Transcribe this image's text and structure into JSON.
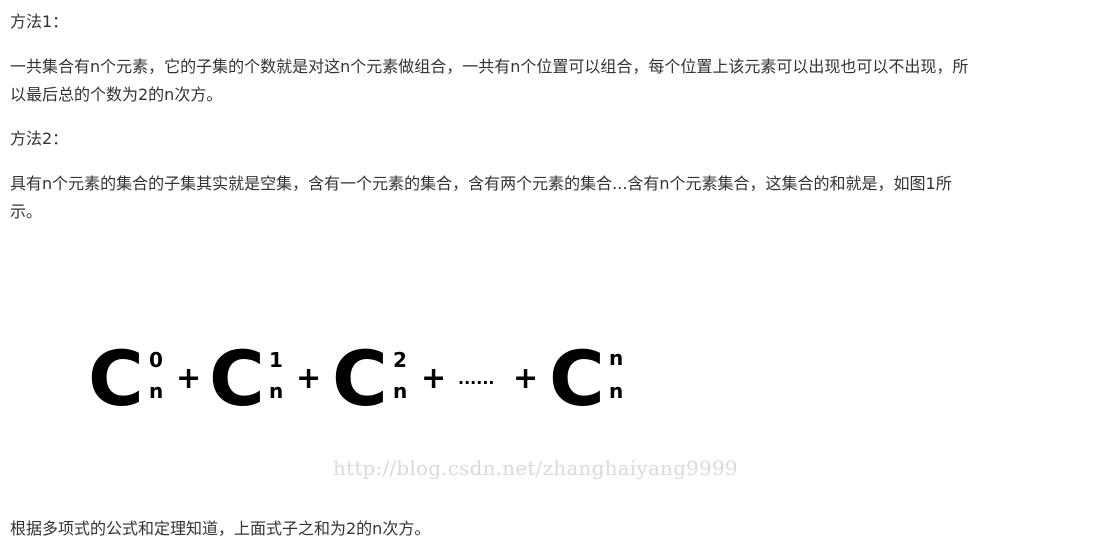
{
  "method1": {
    "heading": "方法1：",
    "lines": [
      "一共集合有n个元素，它的子集的个数就是对这n个元素做组合，一共有n个位置可以组合，每个位置上该元素可以出现也可以不出现，所",
      "以最后总的个数为2的n次方。"
    ]
  },
  "method2": {
    "heading": "方法2：",
    "lines": [
      "具有n个元素的集合的子集其实就是空集，含有一个元素的集合，含有两个元素的集合...含有n个元素集合，这集合的和就是，如图1所",
      "示。"
    ]
  },
  "figure": {
    "terms": [
      {
        "letter": "C",
        "sup": "0",
        "sub": "n"
      },
      {
        "letter": "C",
        "sup": "1",
        "sub": "n"
      },
      {
        "letter": "C",
        "sup": "2",
        "sub": "n"
      },
      {
        "letter": "C",
        "sup": "n",
        "sub": "n"
      }
    ],
    "plus": "+",
    "ellipsis": "......",
    "watermark": "http://blog.csdn.net/zhanghaiyang9999"
  },
  "conclusion": "根据多项式的公式和定理知道，上面式子之和为2的n次方。"
}
